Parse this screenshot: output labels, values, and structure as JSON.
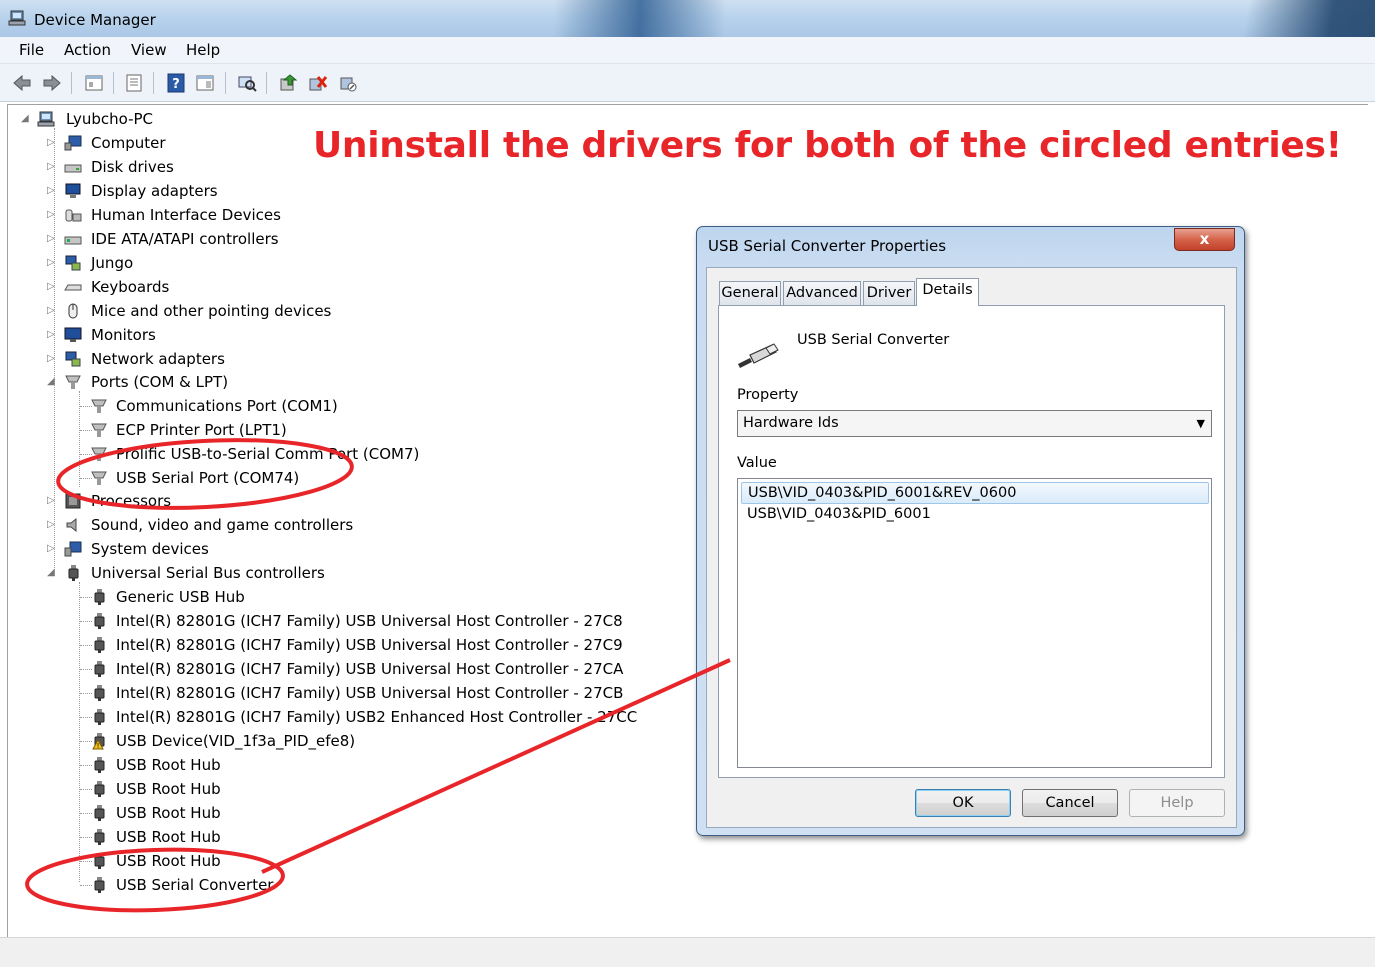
{
  "window": {
    "title": "Device Manager"
  },
  "menu": [
    "File",
    "Action",
    "View",
    "Help"
  ],
  "toolbar_icons": [
    "back-arrow-icon",
    "forward-arrow-icon",
    "properties-grid-icon",
    "console-tree-icon",
    "help-icon",
    "action-pane-icon",
    "scan-hardware-icon",
    "update-driver-icon",
    "uninstall-device-icon",
    "disable-device-icon"
  ],
  "tree": {
    "root": "Lyubcho-PC",
    "categories": [
      {
        "label": "Computer"
      },
      {
        "label": "Disk drives"
      },
      {
        "label": "Display adapters"
      },
      {
        "label": "Human Interface Devices"
      },
      {
        "label": "IDE ATA/ATAPI controllers"
      },
      {
        "label": "Jungo"
      },
      {
        "label": "Keyboards"
      },
      {
        "label": "Mice and other pointing devices"
      },
      {
        "label": "Monitors"
      },
      {
        "label": "Network adapters"
      },
      {
        "label": "Ports (COM & LPT)"
      },
      {
        "label": "Processors"
      },
      {
        "label": "Sound, video and game controllers"
      },
      {
        "label": "System devices"
      },
      {
        "label": "Universal Serial Bus controllers"
      }
    ],
    "ports_children": [
      "Communications Port (COM1)",
      "ECP Printer Port (LPT1)",
      "Prolific USB-to-Serial Comm Port (COM7)",
      "USB Serial Port (COM74)"
    ],
    "usb_children": [
      "Generic USB Hub",
      "Intel(R) 82801G (ICH7 Family) USB Universal Host Controller - 27C8",
      "Intel(R) 82801G (ICH7 Family) USB Universal Host Controller - 27C9",
      "Intel(R) 82801G (ICH7 Family) USB Universal Host Controller - 27CA",
      "Intel(R) 82801G (ICH7 Family) USB Universal Host Controller - 27CB",
      "Intel(R) 82801G (ICH7 Family) USB2 Enhanced Host Controller - 27CC",
      "USB Device(VID_1f3a_PID_efe8)",
      "USB Root Hub",
      "USB Root Hub",
      "USB Root Hub",
      "USB Root Hub",
      "USB Root Hub",
      "USB Serial Converter"
    ]
  },
  "annotation": {
    "text": "Uninstall the drivers for both of the circled entries!",
    "color": "#e8262a"
  },
  "dialog": {
    "title": "USB Serial Converter Properties",
    "close": "x",
    "tabs": [
      "General",
      "Advanced",
      "Driver",
      "Details"
    ],
    "active_tab": "Details",
    "device_name": "USB Serial Converter",
    "property_label": "Property",
    "property_value": "Hardware Ids",
    "value_label": "Value",
    "values": [
      "USB\\VID_0403&PID_6001&REV_0600",
      "USB\\VID_0403&PID_6001"
    ],
    "buttons": {
      "ok": "OK",
      "cancel": "Cancel",
      "help": "Help"
    }
  }
}
